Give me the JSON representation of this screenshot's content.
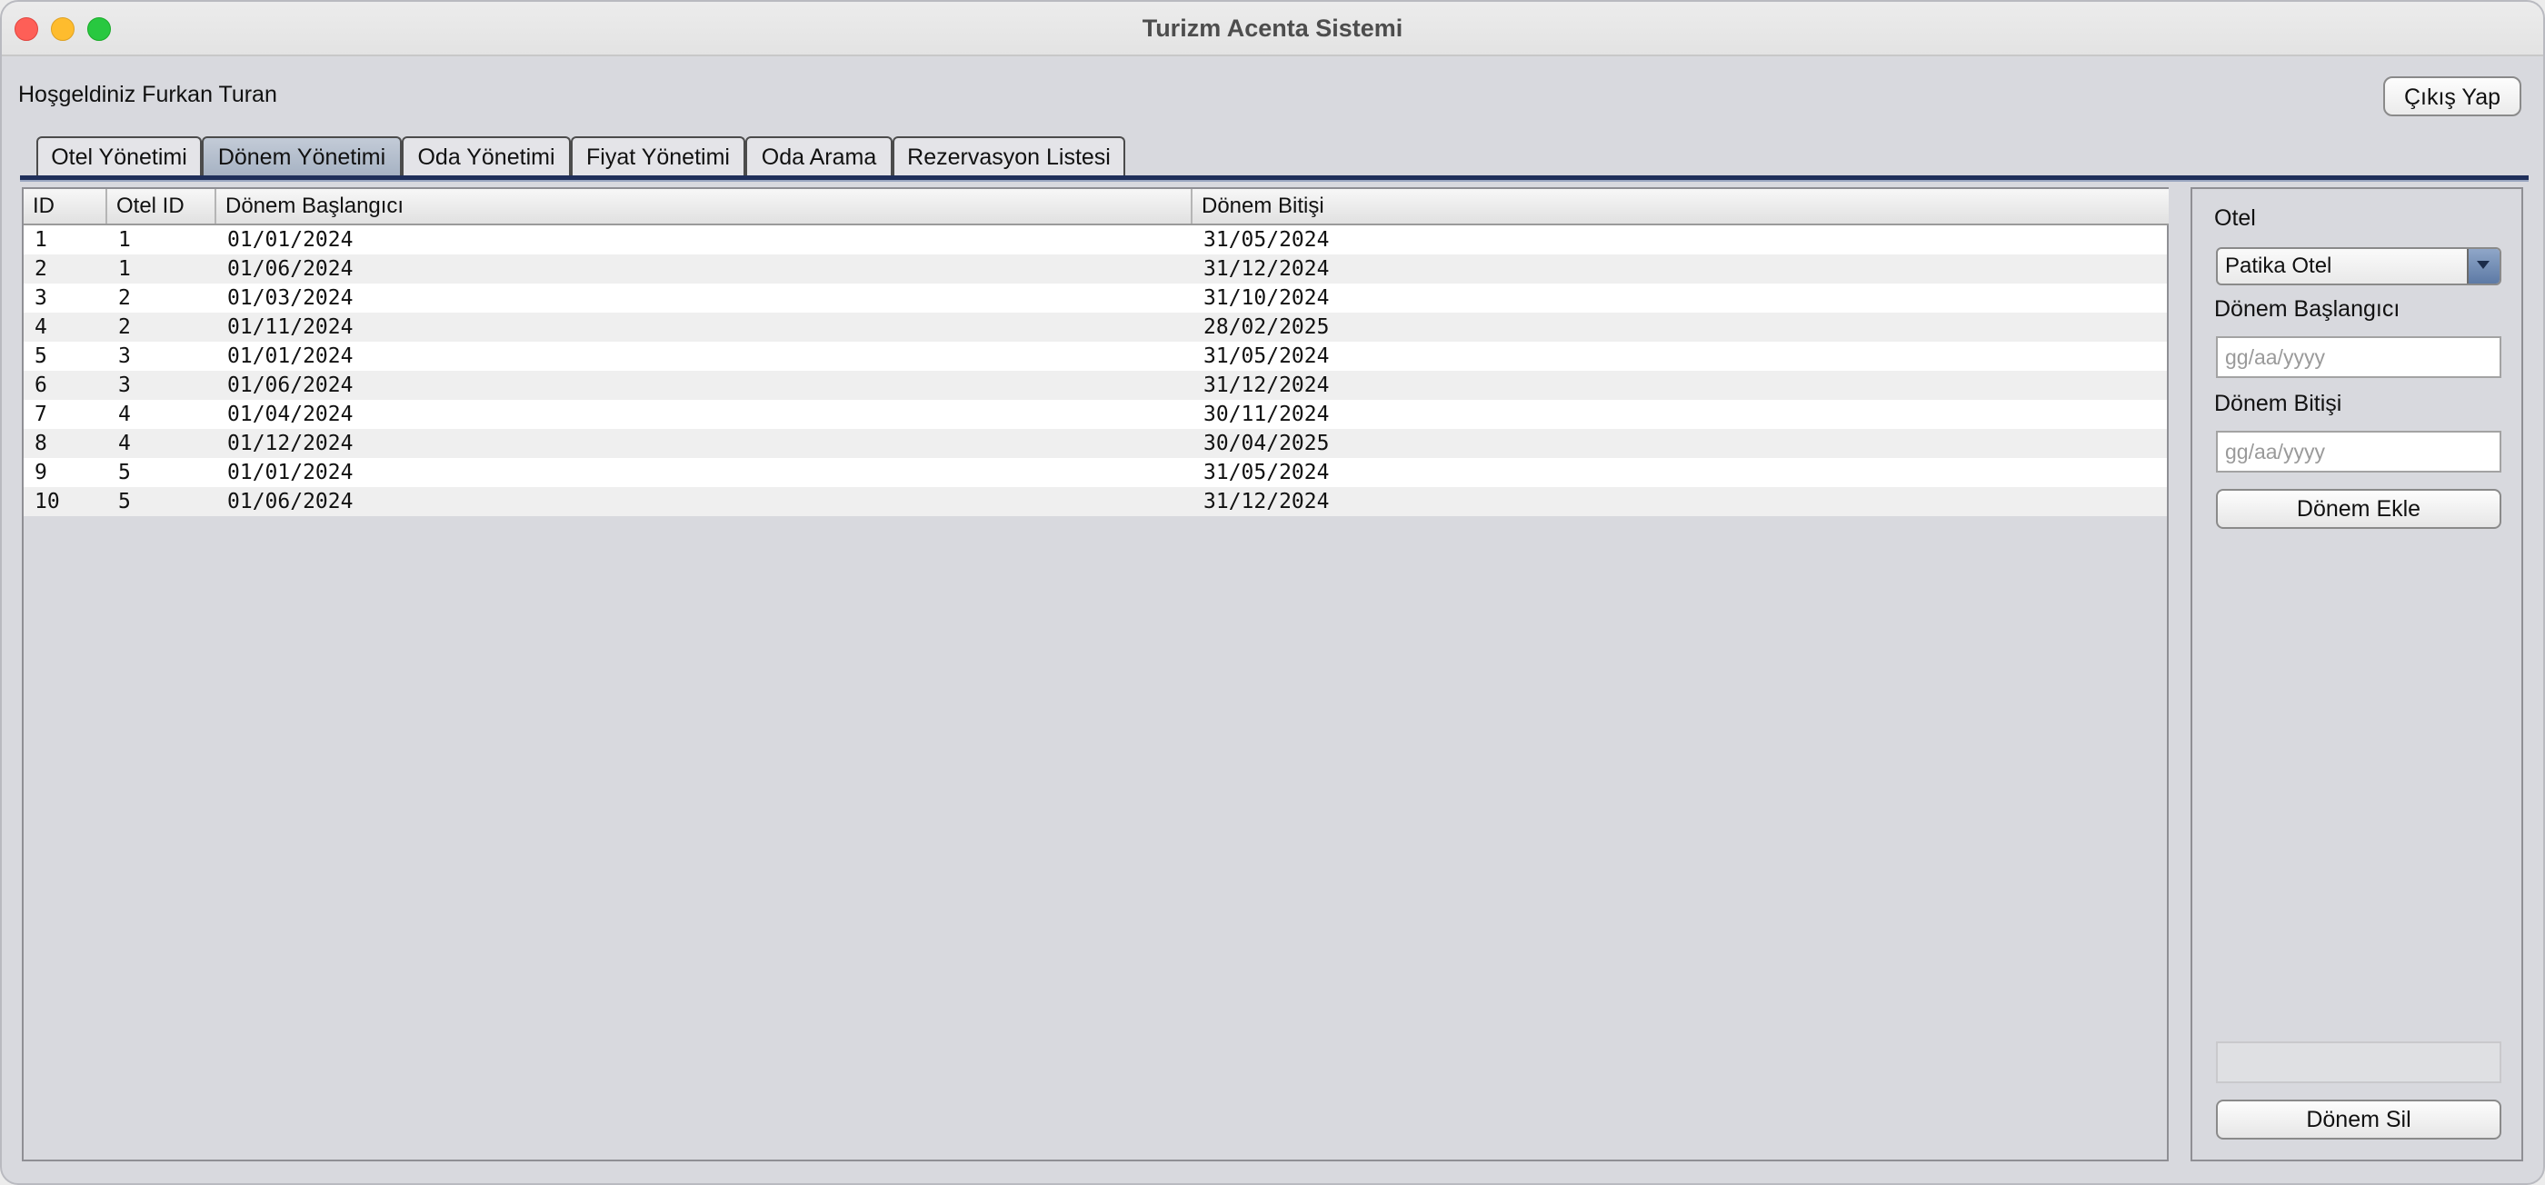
{
  "window": {
    "title": "Turizm Acenta Sistemi"
  },
  "header": {
    "welcome": "Hoşgeldiniz Furkan Turan",
    "logout_label": "Çıkış Yap"
  },
  "tabs": [
    {
      "label": "Otel Yönetimi",
      "active": false
    },
    {
      "label": "Dönem Yönetimi",
      "active": true
    },
    {
      "label": "Oda Yönetimi",
      "active": false
    },
    {
      "label": "Fiyat Yönetimi",
      "active": false
    },
    {
      "label": "Oda Arama",
      "active": false
    },
    {
      "label": "Rezervasyon Listesi",
      "active": false
    }
  ],
  "table": {
    "columns": [
      "ID",
      "Otel ID",
      "Dönem Başlangıcı",
      "Dönem Bitişi"
    ],
    "rows": [
      [
        "1",
        "1",
        "01/01/2024",
        "31/05/2024"
      ],
      [
        "2",
        "1",
        "01/06/2024",
        "31/12/2024"
      ],
      [
        "3",
        "2",
        "01/03/2024",
        "31/10/2024"
      ],
      [
        "4",
        "2",
        "01/11/2024",
        "28/02/2025"
      ],
      [
        "5",
        "3",
        "01/01/2024",
        "31/05/2024"
      ],
      [
        "6",
        "3",
        "01/06/2024",
        "31/12/2024"
      ],
      [
        "7",
        "4",
        "01/04/2024",
        "30/11/2024"
      ],
      [
        "8",
        "4",
        "01/12/2024",
        "30/04/2025"
      ],
      [
        "9",
        "5",
        "01/01/2024",
        "31/05/2024"
      ],
      [
        "10",
        "5",
        "01/06/2024",
        "31/12/2024"
      ]
    ]
  },
  "form": {
    "hotel_label": "Otel",
    "hotel_selected": "Patika Otel",
    "start_label": "Dönem Başlangıcı",
    "start_placeholder": "gg/aa/yyyy",
    "end_label": "Dönem Bitişi",
    "end_placeholder": "gg/aa/yyyy",
    "add_button": "Dönem Ekle",
    "delete_button": "Dönem Sil"
  },
  "icons": {
    "combo_arrow": "chevron-down-icon"
  },
  "colors": {
    "active_tab": "#a6b2c3",
    "tab_rule": "#1f2f5a",
    "combo_arrow": "#5d7aa5"
  }
}
